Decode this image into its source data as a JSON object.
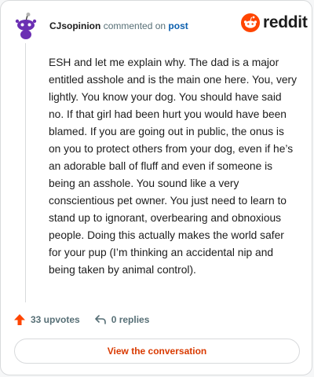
{
  "header": {
    "username": "CJsopinion",
    "action_text": "commented on",
    "post_link": "post"
  },
  "logo": {
    "wordmark": "reddit",
    "icon": "reddit-snoo-icon"
  },
  "avatar": {
    "icon": "snoo-avatar-icon"
  },
  "comment": {
    "body": "ESH and let me explain why. The dad is a major entitled asshole and is the main one here. You, very lightly. You know your dog. You should have said no. If that girl had been hurt you would have been blamed. If you are going out in public, the onus is on you to protect others from your dog, even if he’s an adorable ball of fluff and even if someone is being an asshole. You sound like a very conscientious pet owner. You just need to learn to stand up to ignorant, overbearing and obnoxious people. Doing this actually makes the world safer for your pup (I’m thinking an accidental nip and being taken by animal control)."
  },
  "actions": {
    "upvotes_label": "33 upvotes",
    "replies_label": "0 replies",
    "upvote_icon": "upvote-arrow-icon",
    "reply_icon": "reply-arrow-icon"
  },
  "footer": {
    "button_label": "View the conversation"
  },
  "colors": {
    "accent": "#d93a00",
    "upvote": "#ff4500",
    "link": "#0b5fae",
    "avatar": "#6b2fb3",
    "text": "#1c1c1c",
    "muted": "#576f76"
  }
}
